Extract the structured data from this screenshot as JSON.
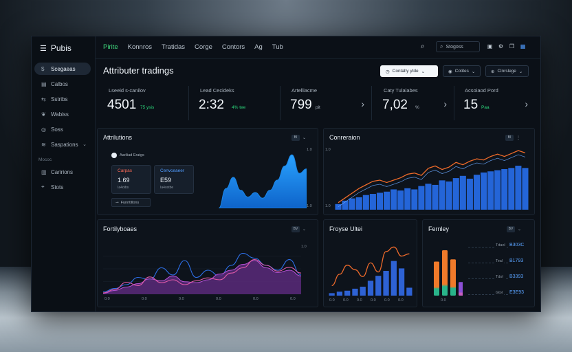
{
  "brand": {
    "name": "Pubis"
  },
  "sidebar": {
    "items": [
      {
        "label": "Scegaeas",
        "icon": "dollar-icon",
        "active": true
      },
      {
        "label": "Calbos",
        "icon": "grid-icon"
      },
      {
        "label": "Sstribs",
        "icon": "share-icon"
      },
      {
        "label": "Wabiss",
        "icon": "leaf-icon"
      },
      {
        "label": "Soss",
        "icon": "circle-icon"
      },
      {
        "label": "Saspations",
        "icon": "layers-icon",
        "has_chevron": true
      }
    ],
    "section_label": "Mococ",
    "items2": [
      {
        "label": "Caririons",
        "icon": "bars-icon"
      },
      {
        "label": "Stots",
        "icon": "pin-icon"
      }
    ]
  },
  "topbar": {
    "tabs": [
      "Pirite",
      "Konnros",
      "Tratidas",
      "Corge",
      "Contors",
      "Ag",
      "Tub"
    ],
    "active_tab": 0,
    "search_placeholder": "Stogoss"
  },
  "header": {
    "title": "Attributer tradings",
    "primary_button": "Contalty ytde",
    "button2": "Cotites",
    "button3": "Cinrslege"
  },
  "kpis": [
    {
      "label": "Lseeid s-canilov",
      "value": "4501",
      "sub": "75 ysis",
      "sub_color": "#2bd47a"
    },
    {
      "label": "Lead Cecideks",
      "value": "2:32",
      "sub": "4% tee",
      "sub_color": "#2bd47a"
    },
    {
      "label": "Artelliacme",
      "value": "799",
      "sub": "pit",
      "sub_color": "#aab4bf"
    },
    {
      "label": "Caty Tulalabes",
      "value": "7,02",
      "sub": "%",
      "sub_color": "#aab4bf"
    },
    {
      "label": "Acsoiaod Pord",
      "value": "15",
      "sub": "Paa",
      "sub_color": "#2bd47a"
    }
  ],
  "panels": {
    "attributions": {
      "title": "Attrilutions",
      "legend_label": "Aariliad Eratgs",
      "card1": {
        "label": "Carpas",
        "value": "1.69",
        "sub": "Ia4oibs"
      },
      "card2": {
        "label": "Cenvceaeer",
        "value": "E59",
        "sub": "Ia4ostbe"
      },
      "footer_button": "Funntillons",
      "badge": "BI",
      "y_axis": [
        "1.0",
        "1.0"
      ],
      "chart_data": {
        "type": "area",
        "x": [
          0,
          1,
          2,
          3,
          4,
          5,
          6,
          7,
          8,
          9,
          10,
          11,
          12
        ],
        "values": [
          0.0,
          0.35,
          0.55,
          0.32,
          0.2,
          0.28,
          0.18,
          0.32,
          0.5,
          0.75,
          0.95,
          0.62,
          0.7
        ],
        "color": "#1a86e8"
      }
    },
    "conversion": {
      "title": "Conreraion",
      "badge": "BI",
      "y_axis": [
        "1.0",
        "1.0"
      ],
      "chart_data": {
        "type": "bar",
        "bars": [
          0.1,
          0.16,
          0.2,
          0.22,
          0.26,
          0.28,
          0.3,
          0.32,
          0.36,
          0.34,
          0.38,
          0.36,
          0.42,
          0.46,
          0.44,
          0.52,
          0.5,
          0.56,
          0.6,
          0.55,
          0.62,
          0.66,
          0.68,
          0.7,
          0.72,
          0.74,
          0.78,
          0.74
        ],
        "line": [
          0.12,
          0.2,
          0.28,
          0.36,
          0.42,
          0.48,
          0.5,
          0.46,
          0.5,
          0.54,
          0.6,
          0.62,
          0.58,
          0.7,
          0.74,
          0.68,
          0.72,
          0.8,
          0.76,
          0.82,
          0.86,
          0.84,
          0.9,
          0.94,
          0.9,
          0.95,
          1.0,
          0.96
        ],
        "bar_color": "#2465d8",
        "line_color": "#ef6b2a"
      }
    },
    "fortility": {
      "title": "Fortilyboaes",
      "badge": "BV",
      "x_axis": [
        "0.0",
        "0.0",
        "0.0",
        "0.0",
        "0.0",
        "0.0"
      ],
      "y_axis": [
        "1.0"
      ],
      "chart_data": {
        "type": "line",
        "series": [
          {
            "values": [
              0.05,
              0.12,
              0.2,
              0.35,
              0.3,
              0.55,
              0.4,
              0.7,
              0.35,
              0.5,
              0.38,
              0.6,
              0.85,
              0.75,
              0.6,
              0.5,
              0.72,
              0.4
            ],
            "color": "#2d6fe8"
          },
          {
            "values": [
              0.02,
              0.08,
              0.15,
              0.22,
              0.32,
              0.28,
              0.38,
              0.26,
              0.24,
              0.3,
              0.42,
              0.5,
              0.62,
              0.7,
              0.55,
              0.45,
              0.5,
              0.38
            ],
            "color": "#b04fd0",
            "fill": "#5b2a7a"
          },
          {
            "values": [
              0.03,
              0.1,
              0.25,
              0.18,
              0.36,
              0.24,
              0.3,
              0.2,
              0.28,
              0.34,
              0.3,
              0.44,
              0.55,
              0.72,
              0.6,
              0.48,
              0.56,
              0.44
            ],
            "color": "#e05aa8"
          }
        ]
      }
    },
    "freyse": {
      "title": "Froyse Ultei",
      "x_axis": [
        "0.0",
        "0.0",
        "0.0",
        "0.0",
        "0.0",
        "0.0"
      ],
      "chart_data": {
        "type": "bar",
        "bars": [
          0.05,
          0.08,
          0.1,
          0.14,
          0.18,
          0.3,
          0.4,
          0.5,
          0.7,
          0.55,
          0.16
        ],
        "line": [
          0.1,
          0.35,
          0.55,
          0.45,
          0.3,
          0.6,
          0.4,
          0.85,
          0.95,
          0.75,
          0.8
        ],
        "bar_color": "#2e62d4",
        "line_color": "#ee6a2b"
      }
    },
    "fernley": {
      "title": "Fernley",
      "badge": "BV",
      "x_axis": [
        "0.0"
      ],
      "rows": [
        {
          "label": "Tdaol",
          "value": "B303C"
        },
        {
          "label": "Teal",
          "value": "B1793"
        },
        {
          "label": "Tdol",
          "value": "B3393"
        },
        {
          "label": "Gtol",
          "value": "E3E93"
        }
      ],
      "chart_data": {
        "type": "bar",
        "bars": [
          0.75,
          1.0,
          0.8,
          0.3
        ],
        "colors": [
          [
            "#f07a2a",
            "#29b48a"
          ],
          [
            "#f07a2a",
            "#29b48a"
          ],
          [
            "#f07a2a",
            "#29b48a"
          ],
          [
            "#8c4fd6",
            "#c65ec0"
          ]
        ]
      }
    }
  }
}
